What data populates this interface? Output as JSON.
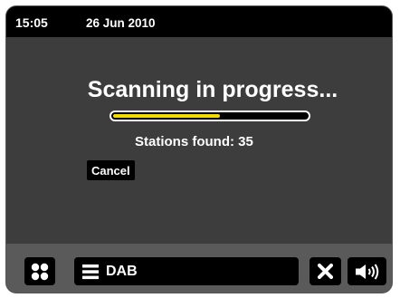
{
  "status_bar": {
    "time": "15:05",
    "date": "26 Jun 2010"
  },
  "main": {
    "title": "Scanning in progress...",
    "progress": 0.55,
    "stations_found": "Stations found: 35",
    "cancel_label": "Cancel"
  },
  "bottom_bar": {
    "source_label": "DAB",
    "icons": {
      "menu": "four-dots-icon",
      "source": "hamburger-icon",
      "close": "close-icon",
      "volume": "volume-icon"
    }
  },
  "colors": {
    "progress_fill": "#f2dc00",
    "screen_background": "#3d3d3d",
    "bottom_bar": "#5a5a5a"
  }
}
